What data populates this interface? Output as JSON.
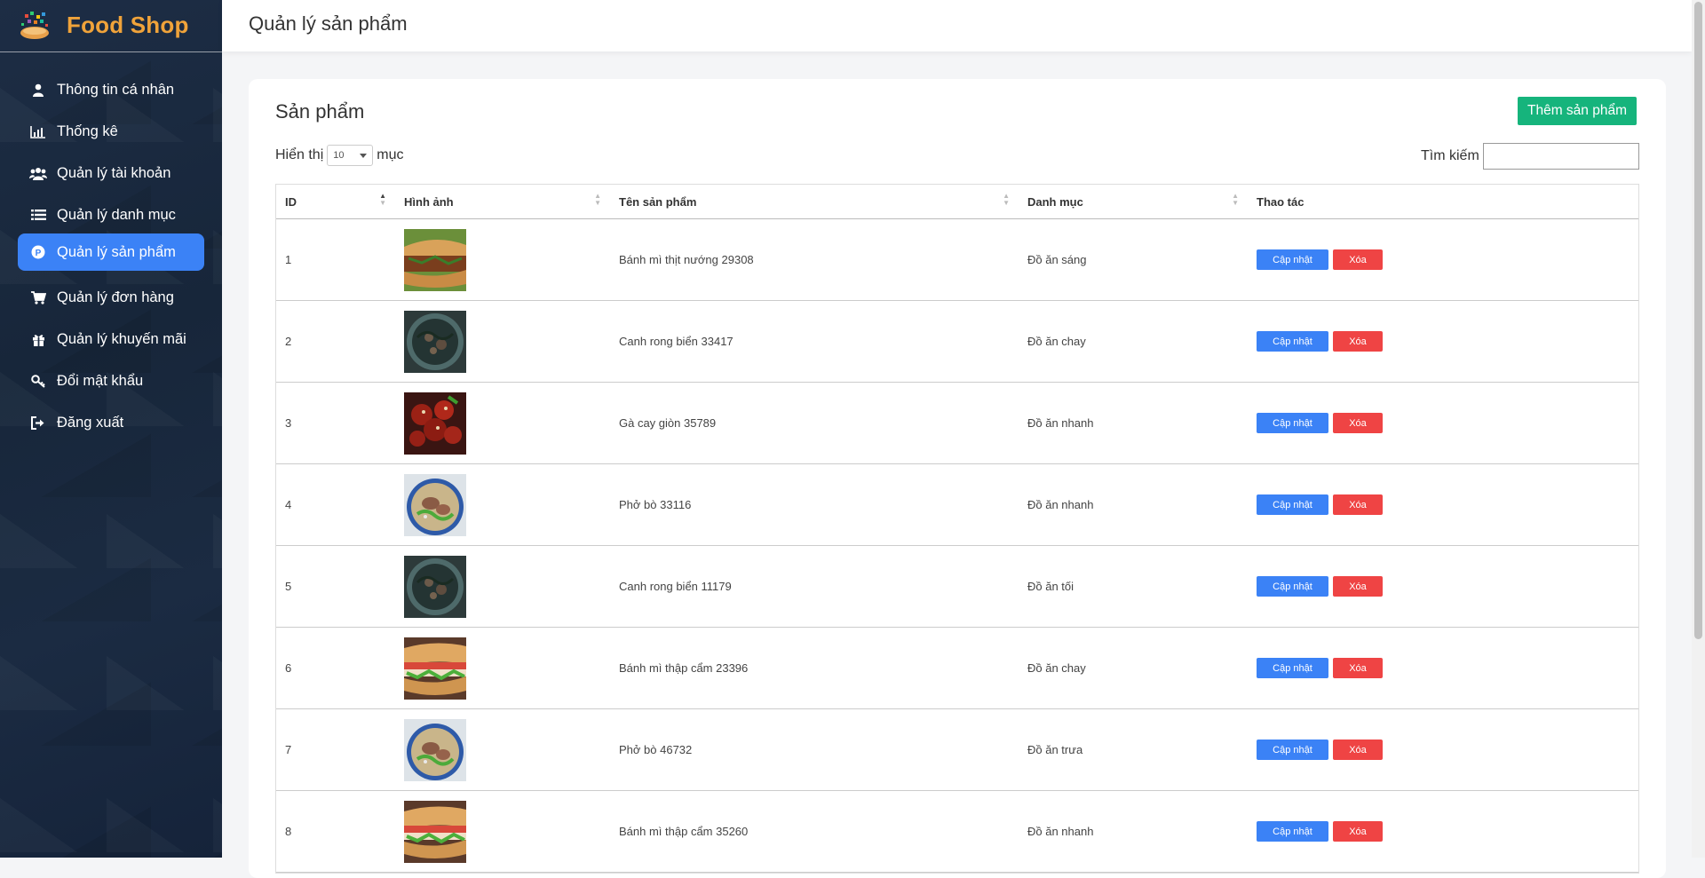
{
  "brand": {
    "name": "Food Shop",
    "logo": "food-logo"
  },
  "sidebar": {
    "items": [
      {
        "label": "Thông tin cá nhân",
        "icon": "user-icon",
        "active": false
      },
      {
        "label": "Thống kê",
        "icon": "bar-chart-icon",
        "active": false
      },
      {
        "label": "Quản lý tài khoản",
        "icon": "users-icon",
        "active": false
      },
      {
        "label": "Quản lý danh mục",
        "icon": "list-icon",
        "active": false
      },
      {
        "label": "Quản lý sản phẩm",
        "icon": "product-badge-icon",
        "active": true
      },
      {
        "label": "Quản lý đơn hàng",
        "icon": "cart-icon",
        "active": false
      },
      {
        "label": "Quản lý khuyến mãi",
        "icon": "gift-icon",
        "active": false
      },
      {
        "label": "Đổi mật khẩu",
        "icon": "key-icon",
        "active": false
      },
      {
        "label": "Đăng xuất",
        "icon": "logout-icon",
        "active": false
      }
    ]
  },
  "header": {
    "title": "Quản lý sản phẩm"
  },
  "card": {
    "title": "Sản phẩm",
    "add_label": "Thêm sản phẩm",
    "length_prefix": "Hiển thị",
    "length_value": "10",
    "length_suffix": "mục",
    "search_label": "Tìm kiếm",
    "search_value": ""
  },
  "table": {
    "columns": [
      "ID",
      "Hình ảnh",
      "Tên sản phẩm",
      "Danh mục",
      "Thao tác"
    ],
    "update_label": "Cập nhật",
    "delete_label": "Xóa",
    "rows": [
      {
        "id": "1",
        "image": "banh-mi-thit-nuong",
        "name": "Bánh mì thịt nướng 29308",
        "category": "Đồ ăn sáng"
      },
      {
        "id": "2",
        "image": "canh-rong-bien",
        "name": "Canh rong biển 33417",
        "category": "Đồ ăn chay"
      },
      {
        "id": "3",
        "image": "ga-cay-gion",
        "name": "Gà cay giòn 35789",
        "category": "Đồ ăn nhanh"
      },
      {
        "id": "4",
        "image": "pho-bo",
        "name": "Phở bò 33116",
        "category": "Đồ ăn nhanh"
      },
      {
        "id": "5",
        "image": "canh-rong-bien",
        "name": "Canh rong biển 11179",
        "category": "Đồ ăn tối"
      },
      {
        "id": "6",
        "image": "banh-mi-thap-cam",
        "name": "Bánh mì thập cẩm 23396",
        "category": "Đồ ăn chay"
      },
      {
        "id": "7",
        "image": "pho-bo",
        "name": "Phở bò 46732",
        "category": "Đồ ăn trưa"
      },
      {
        "id": "8",
        "image": "banh-mi-thap-cam",
        "name": "Bánh mì thập cẩm 35260",
        "category": "Đồ ăn nhanh"
      }
    ]
  },
  "colors": {
    "sidebar_bg": "#1b2b42",
    "brand": "#f0a33a",
    "active": "#3b82f6",
    "add": "#16b47c",
    "update": "#3b82f6",
    "delete": "#ef4444"
  }
}
